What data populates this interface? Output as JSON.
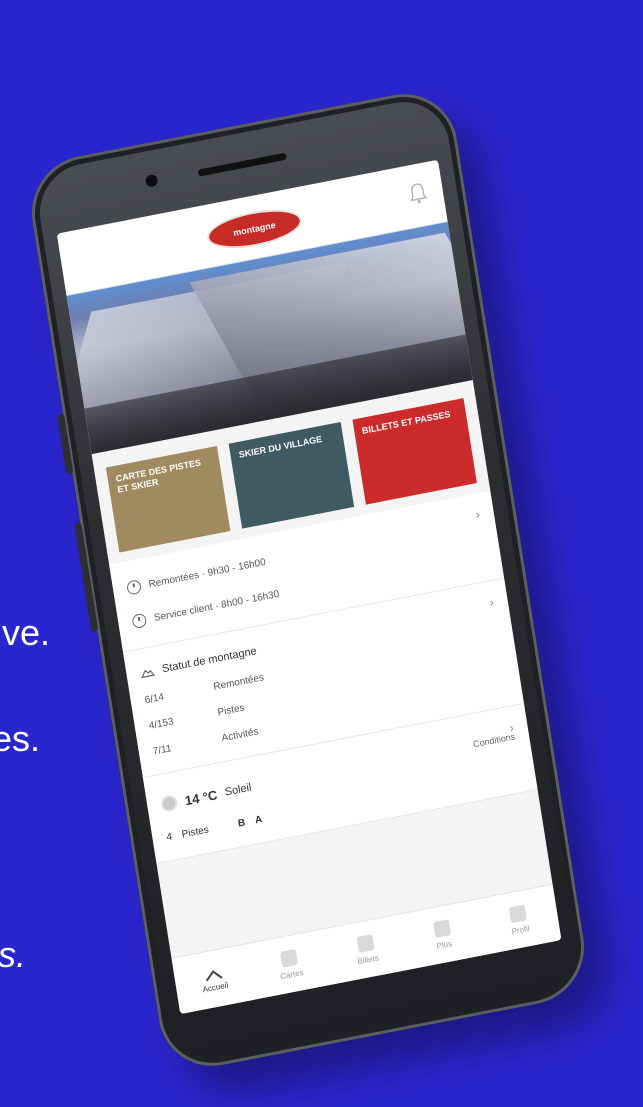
{
  "background_color": "#2a26cf",
  "side_text": {
    "line1": "ive.",
    "line2": "es.",
    "line3": "ıs."
  },
  "app": {
    "logo_text": "montagne",
    "header_icon": "bell-icon",
    "tiles": [
      {
        "label": "CARTE DES PISTES ET SKIER",
        "color": "#a08a5f"
      },
      {
        "label": "SKIER DU VILLAGE",
        "color": "#3f5a62"
      },
      {
        "label": "BILLETS ET PASSES",
        "color": "#cc2b2b"
      }
    ],
    "hours": {
      "lifts": "Remontées · 9h30 - 16h00",
      "service": "Service client · 8h00 - 16h30"
    },
    "status": {
      "title": "Statut de montagne",
      "rows": [
        {
          "value": "6/14",
          "label": "Remontées"
        },
        {
          "value": "4/153",
          "label": "Pistes"
        },
        {
          "value": "7/11",
          "label": "Activités"
        }
      ]
    },
    "weather": {
      "temp": "14 °C",
      "condition": "Soleil",
      "link": "Conditions"
    },
    "lifts_row": {
      "count": "4",
      "label": "Pistes",
      "a": "B",
      "b": "A"
    },
    "tabs": [
      {
        "label": "Accueil",
        "icon": "home-icon"
      },
      {
        "label": "Cartes",
        "icon": "map-icon"
      },
      {
        "label": "Billets",
        "icon": "ticket-icon"
      },
      {
        "label": "Plus",
        "icon": "more-icon"
      },
      {
        "label": "Profil",
        "icon": "user-icon"
      }
    ]
  }
}
